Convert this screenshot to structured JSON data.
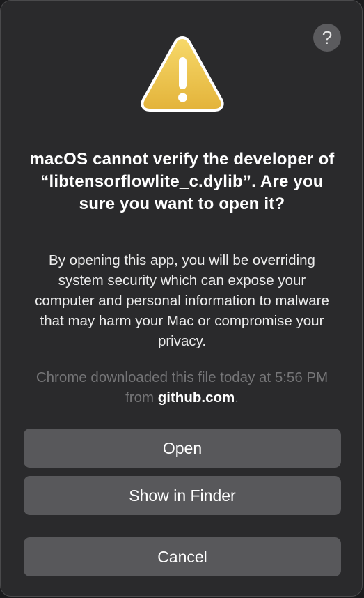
{
  "dialog": {
    "help_label": "?",
    "icon": "warning-triangle-icon",
    "title": "macOS cannot verify the developer of “libtensorflowlite_c.dylib”. Are you sure you want to open it?",
    "message": "By opening this app, you will be overriding system security which can expose your computer and personal information to malware that may harm your Mac or compromise your privacy.",
    "source_prefix": "Chrome downloaded this file today at 5:56 PM from ",
    "source_host": "github.com",
    "source_suffix": ".",
    "buttons": {
      "open": "Open",
      "show_in_finder": "Show in Finder",
      "cancel": "Cancel"
    }
  },
  "colors": {
    "background": "#2a2a2c",
    "button": "#58585b",
    "warning_yellow": "#f2c94c",
    "secondary_text": "#757577"
  }
}
